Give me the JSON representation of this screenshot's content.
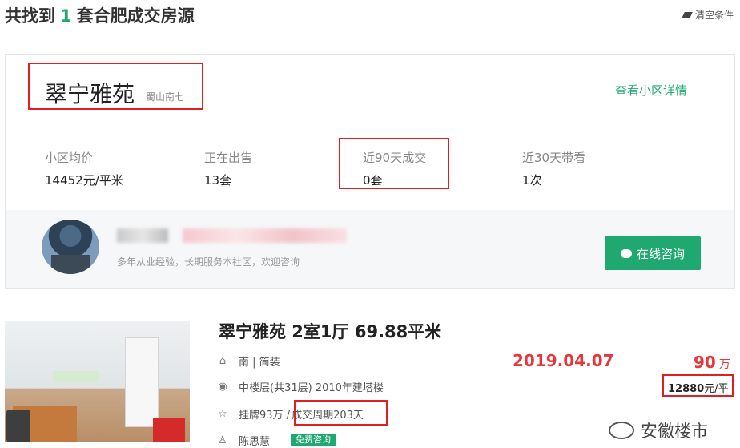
{
  "header": {
    "title_prefix": "共找到",
    "count": "1",
    "title_suffix": "套合肥成交房源",
    "clear_label": "清空条件"
  },
  "community": {
    "name": "翠宁雅苑",
    "area": "蜀山南七",
    "detail_link": "查看小区详情",
    "stats": [
      {
        "label": "小区均价",
        "value": "14452元/平米"
      },
      {
        "label": "正在出售",
        "value": "13套"
      },
      {
        "label": "近90天成交",
        "value": "0套"
      },
      {
        "label": "近30天带看",
        "value": "1次"
      }
    ]
  },
  "agent": {
    "description": "多年从业经验，长期服务本社区，欢迎咨询",
    "consult_button": "在线咨询"
  },
  "listing": {
    "title": "翠宁雅苑 2室1厅 69.88平米",
    "orientation": "南 | 简装",
    "floor": "中楼层(共31层) 2010年建塔楼",
    "listing_price": "挂牌93万 /",
    "deal_cycle": "成交周期203天",
    "agent_name": "陈思慧",
    "consult_tag": "免费咨询",
    "deal_date": "2019.04.07",
    "deal_price": "90",
    "deal_price_unit": "万",
    "unit_price_value": "12880",
    "unit_price_unit": "元/平"
  },
  "watermark": "安徽楼市",
  "colors": {
    "accent_green": "#1fa971",
    "price_red": "#e4393c",
    "highlight_red": "#e02020"
  }
}
